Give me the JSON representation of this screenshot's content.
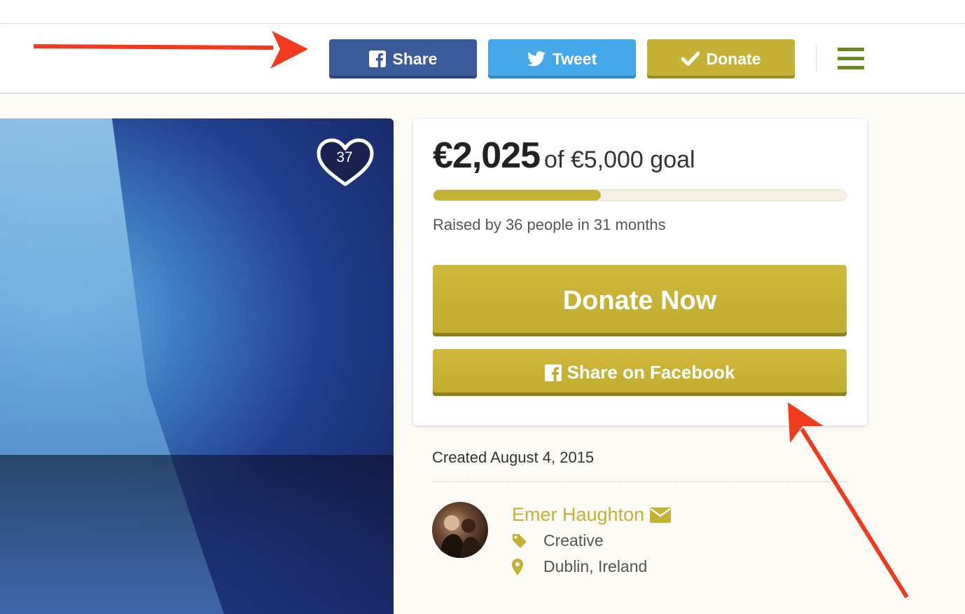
{
  "header": {
    "share_label": "Share",
    "tweet_label": "Tweet",
    "donate_label": "Donate",
    "menu_icon": "hamburger-icon"
  },
  "photo": {
    "heart_count": "37"
  },
  "campaign": {
    "raised": "€2,025",
    "goal_text": "of €5,000 goal",
    "progress_fraction": 0.405,
    "raised_by": "Raised by 36 people in 31 months",
    "donate_now_label": "Donate Now",
    "share_facebook_label": "Share on Facebook"
  },
  "details": {
    "created": "Created August 4, 2015",
    "organizer_name": "Emer Haughton",
    "category": "Creative",
    "location": "Dublin, Ireland"
  },
  "colors": {
    "facebook": "#3b5a9a",
    "twitter": "#45a8e8",
    "gold": "#c5b135",
    "menu": "#6a8a1e",
    "annotation": "#f23a1f"
  }
}
